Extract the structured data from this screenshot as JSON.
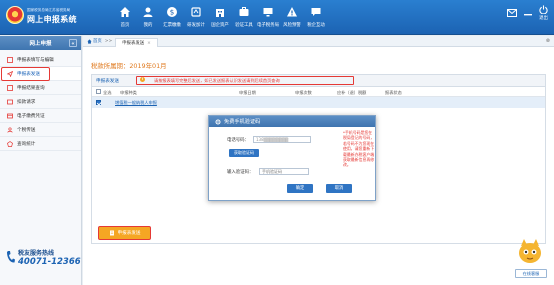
{
  "app": {
    "sub_title": "国家税务总局江苏省税务局",
    "title": "网上申报系统"
  },
  "nav": [
    {
      "label": "首页",
      "icon": "home-icon"
    },
    {
      "label": "我的",
      "icon": "user-icon"
    },
    {
      "label": "汇票缴缴",
      "icon": "money-icon"
    },
    {
      "label": "研发加计",
      "icon": "research-icon"
    },
    {
      "label": "国企资产",
      "icon": "building-icon"
    },
    {
      "label": "验证工具",
      "icon": "tool-icon"
    },
    {
      "label": "电子税务局",
      "icon": "tax-bureau-icon"
    },
    {
      "label": "风险预警",
      "icon": "warning-icon"
    },
    {
      "label": "税企互动",
      "icon": "chat-icon"
    }
  ],
  "topright": {
    "exit_label": "退出"
  },
  "sidebar": {
    "header": "网上申报",
    "items": [
      {
        "label": "申报表填写与编辑",
        "icon": "edit-icon"
      },
      {
        "label": "申报表发送",
        "icon": "send-icon"
      },
      {
        "label": "申报结果查询",
        "icon": "search-icon"
      },
      {
        "label": "扣款请求",
        "icon": "deduct-icon"
      },
      {
        "label": "电子缴费凭证",
        "icon": "receipt-icon"
      },
      {
        "label": "个税传送",
        "icon": "person-icon"
      },
      {
        "label": "查询统计",
        "icon": "chart-icon"
      }
    ],
    "hotline_title": "税友服务热线",
    "hotline_number": "40071-12366"
  },
  "breadcrumb": {
    "home": "首页",
    "sep": ">>",
    "current_tab": "申报表发送",
    "tab_close": "×"
  },
  "main": {
    "period": "税款所属期：2019年01月",
    "panel_title": "申报表发送",
    "notice": "请按报表填写完整后发送，如已发送报表认识发送请到后续首页查询",
    "columns": [
      "全选",
      "申报种类",
      "申报日期",
      "申报次数",
      "应补（退）税额",
      "报表状态"
    ],
    "rows": [
      {
        "name": "增值税一般纳税人申报"
      }
    ],
    "send_button": "申报表发送"
  },
  "modal": {
    "title": "免费手机验证码",
    "phone_label": "电话号码：",
    "phone_value": "138▒▒▒▒▒▒▒▒",
    "get_code": "获取验证码",
    "code_label": "输入验证码：",
    "code_placeholder": "手机验证码",
    "note": "*手机号码是您在税局登记的号码，若号码不为您现在使用，请您重新下载最新办税客户端获取最新信息再修改。",
    "ok": "确定",
    "cancel": "取消"
  },
  "online_service": "在线客服",
  "colors": {
    "brand_blue": "#1c63b3",
    "accent_orange": "#f5a623",
    "highlight_red": "#e53935"
  }
}
